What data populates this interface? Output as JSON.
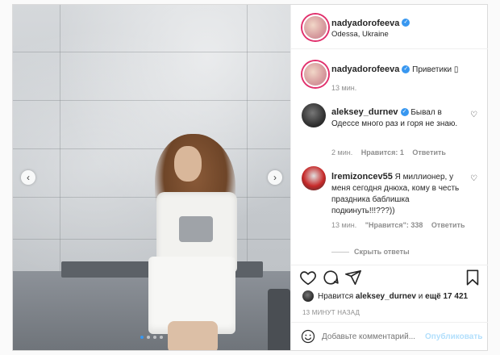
{
  "post": {
    "author": "nadyadorofeeva",
    "location": "Odessa, Ukraine",
    "caption_author": "nadyadorofeeva",
    "caption": "Приветики ▯",
    "caption_time": "13 мин."
  },
  "comments": [
    {
      "user": "aleksey_durnev",
      "verified": true,
      "text": "Бывал в Одессе много раз и горя не знаю.",
      "time": "2 мин.",
      "likes": "Нравится: 1",
      "reply": "Ответить"
    },
    {
      "user": "lremizoncev55",
      "verified": false,
      "text": "Я миллионер, у меня сегодня днюха, кому в честь праздника баблишка подкинуть!!!???))",
      "time": "13 мин.",
      "likes": "\"Нравится\": 338",
      "reply": "Ответить",
      "hide_replies": "Скрыть ответы"
    }
  ],
  "likes_line": {
    "prefix": "Нравится",
    "user": "aleksey_durnev",
    "middle": "и",
    "count": "ещё 17 421"
  },
  "timestamp": "13 МИНУТ НАЗАД",
  "comment_box": {
    "placeholder": "Добавьте комментарий...",
    "publish": "Опубликовать"
  },
  "carousel": {
    "current": 1,
    "total": 4
  },
  "colors": {
    "accent": "#3897f0",
    "publish_disabled": "#b2dffc",
    "border": "#dbdbdb"
  }
}
